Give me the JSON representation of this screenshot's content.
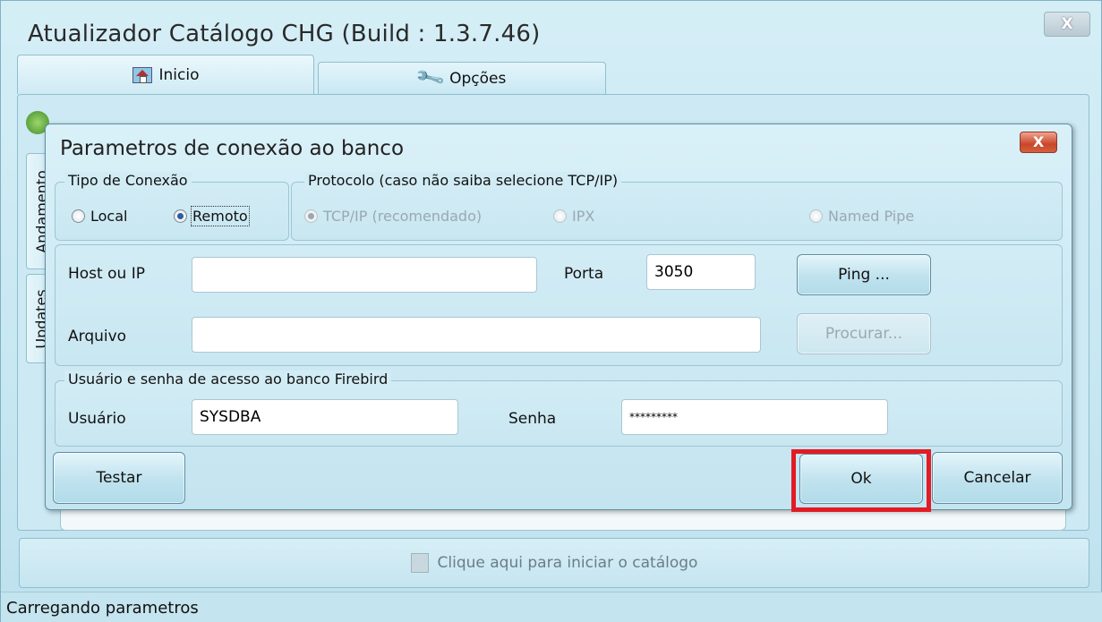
{
  "window": {
    "title": "Atualizador Catálogo CHG  (Build : 1.3.7.46)",
    "close_label": "X"
  },
  "tabs": [
    {
      "label": "Inicio",
      "icon": "house-icon",
      "active": true
    },
    {
      "label": "Opções",
      "icon": "wrench-icon",
      "active": false
    }
  ],
  "side_tabs": [
    "Andamento",
    "Updates"
  ],
  "bottom": {
    "start_catalog_label": "Clique aqui para iniciar o catálogo"
  },
  "status": {
    "text": "Carregando parametros"
  },
  "dialog": {
    "title": "Parametros de conexão ao banco",
    "close_label": "X",
    "tipo_conexao": {
      "legend": "Tipo de Conexão",
      "options": [
        {
          "label": "Local",
          "checked": false
        },
        {
          "label": "Remoto",
          "checked": true
        }
      ]
    },
    "protocolo": {
      "legend": "Protocolo (caso não saiba selecione TCP/IP)",
      "options": [
        {
          "label": "TCP/IP (recomendado)",
          "checked": true,
          "enabled": false
        },
        {
          "label": "IPX",
          "checked": false,
          "enabled": false
        },
        {
          "label": "Named Pipe",
          "checked": false,
          "enabled": false
        }
      ]
    },
    "host_label": "Host ou IP",
    "host_value": "",
    "porta_label": "Porta",
    "porta_value": "3050",
    "ping_label": "Ping ...",
    "arquivo_label": "Arquivo",
    "arquivo_value": "",
    "procurar_label": "Procurar...",
    "credentials": {
      "legend": "Usuário e senha de acesso ao banco Firebird",
      "usuario_label": "Usuário",
      "usuario_value": "SYSDBA",
      "senha_label": "Senha",
      "senha_value": "*********"
    },
    "testar_label": "Testar",
    "ok_label": "Ok",
    "cancelar_label": "Cancelar"
  },
  "colors": {
    "highlight": "#e21b24",
    "close_button": "#c8462b"
  }
}
